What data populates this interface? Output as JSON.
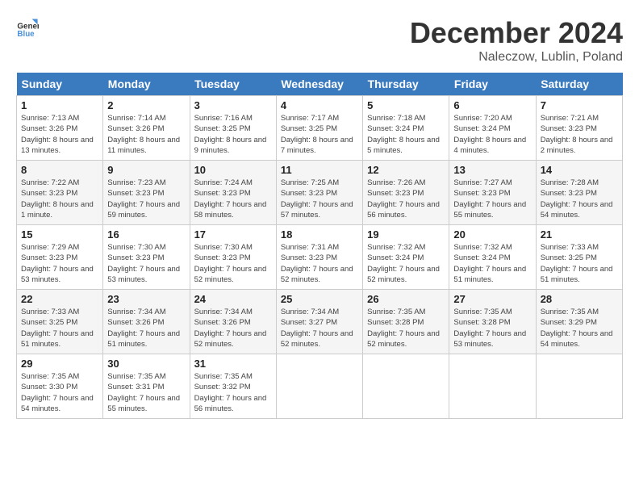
{
  "header": {
    "logo_line1": "General",
    "logo_line2": "Blue",
    "month": "December 2024",
    "location": "Naleczow, Lublin, Poland"
  },
  "weekdays": [
    "Sunday",
    "Monday",
    "Tuesday",
    "Wednesday",
    "Thursday",
    "Friday",
    "Saturday"
  ],
  "weeks": [
    [
      {
        "day": "1",
        "sunrise": "Sunrise: 7:13 AM",
        "sunset": "Sunset: 3:26 PM",
        "daylight": "Daylight: 8 hours and 13 minutes."
      },
      {
        "day": "2",
        "sunrise": "Sunrise: 7:14 AM",
        "sunset": "Sunset: 3:26 PM",
        "daylight": "Daylight: 8 hours and 11 minutes."
      },
      {
        "day": "3",
        "sunrise": "Sunrise: 7:16 AM",
        "sunset": "Sunset: 3:25 PM",
        "daylight": "Daylight: 8 hours and 9 minutes."
      },
      {
        "day": "4",
        "sunrise": "Sunrise: 7:17 AM",
        "sunset": "Sunset: 3:25 PM",
        "daylight": "Daylight: 8 hours and 7 minutes."
      },
      {
        "day": "5",
        "sunrise": "Sunrise: 7:18 AM",
        "sunset": "Sunset: 3:24 PM",
        "daylight": "Daylight: 8 hours and 5 minutes."
      },
      {
        "day": "6",
        "sunrise": "Sunrise: 7:20 AM",
        "sunset": "Sunset: 3:24 PM",
        "daylight": "Daylight: 8 hours and 4 minutes."
      },
      {
        "day": "7",
        "sunrise": "Sunrise: 7:21 AM",
        "sunset": "Sunset: 3:23 PM",
        "daylight": "Daylight: 8 hours and 2 minutes."
      }
    ],
    [
      {
        "day": "8",
        "sunrise": "Sunrise: 7:22 AM",
        "sunset": "Sunset: 3:23 PM",
        "daylight": "Daylight: 8 hours and 1 minute."
      },
      {
        "day": "9",
        "sunrise": "Sunrise: 7:23 AM",
        "sunset": "Sunset: 3:23 PM",
        "daylight": "Daylight: 7 hours and 59 minutes."
      },
      {
        "day": "10",
        "sunrise": "Sunrise: 7:24 AM",
        "sunset": "Sunset: 3:23 PM",
        "daylight": "Daylight: 7 hours and 58 minutes."
      },
      {
        "day": "11",
        "sunrise": "Sunrise: 7:25 AM",
        "sunset": "Sunset: 3:23 PM",
        "daylight": "Daylight: 7 hours and 57 minutes."
      },
      {
        "day": "12",
        "sunrise": "Sunrise: 7:26 AM",
        "sunset": "Sunset: 3:23 PM",
        "daylight": "Daylight: 7 hours and 56 minutes."
      },
      {
        "day": "13",
        "sunrise": "Sunrise: 7:27 AM",
        "sunset": "Sunset: 3:23 PM",
        "daylight": "Daylight: 7 hours and 55 minutes."
      },
      {
        "day": "14",
        "sunrise": "Sunrise: 7:28 AM",
        "sunset": "Sunset: 3:23 PM",
        "daylight": "Daylight: 7 hours and 54 minutes."
      }
    ],
    [
      {
        "day": "15",
        "sunrise": "Sunrise: 7:29 AM",
        "sunset": "Sunset: 3:23 PM",
        "daylight": "Daylight: 7 hours and 53 minutes."
      },
      {
        "day": "16",
        "sunrise": "Sunrise: 7:30 AM",
        "sunset": "Sunset: 3:23 PM",
        "daylight": "Daylight: 7 hours and 53 minutes."
      },
      {
        "day": "17",
        "sunrise": "Sunrise: 7:30 AM",
        "sunset": "Sunset: 3:23 PM",
        "daylight": "Daylight: 7 hours and 52 minutes."
      },
      {
        "day": "18",
        "sunrise": "Sunrise: 7:31 AM",
        "sunset": "Sunset: 3:23 PM",
        "daylight": "Daylight: 7 hours and 52 minutes."
      },
      {
        "day": "19",
        "sunrise": "Sunrise: 7:32 AM",
        "sunset": "Sunset: 3:24 PM",
        "daylight": "Daylight: 7 hours and 52 minutes."
      },
      {
        "day": "20",
        "sunrise": "Sunrise: 7:32 AM",
        "sunset": "Sunset: 3:24 PM",
        "daylight": "Daylight: 7 hours and 51 minutes."
      },
      {
        "day": "21",
        "sunrise": "Sunrise: 7:33 AM",
        "sunset": "Sunset: 3:25 PM",
        "daylight": "Daylight: 7 hours and 51 minutes."
      }
    ],
    [
      {
        "day": "22",
        "sunrise": "Sunrise: 7:33 AM",
        "sunset": "Sunset: 3:25 PM",
        "daylight": "Daylight: 7 hours and 51 minutes."
      },
      {
        "day": "23",
        "sunrise": "Sunrise: 7:34 AM",
        "sunset": "Sunset: 3:26 PM",
        "daylight": "Daylight: 7 hours and 51 minutes."
      },
      {
        "day": "24",
        "sunrise": "Sunrise: 7:34 AM",
        "sunset": "Sunset: 3:26 PM",
        "daylight": "Daylight: 7 hours and 52 minutes."
      },
      {
        "day": "25",
        "sunrise": "Sunrise: 7:34 AM",
        "sunset": "Sunset: 3:27 PM",
        "daylight": "Daylight: 7 hours and 52 minutes."
      },
      {
        "day": "26",
        "sunrise": "Sunrise: 7:35 AM",
        "sunset": "Sunset: 3:28 PM",
        "daylight": "Daylight: 7 hours and 52 minutes."
      },
      {
        "day": "27",
        "sunrise": "Sunrise: 7:35 AM",
        "sunset": "Sunset: 3:28 PM",
        "daylight": "Daylight: 7 hours and 53 minutes."
      },
      {
        "day": "28",
        "sunrise": "Sunrise: 7:35 AM",
        "sunset": "Sunset: 3:29 PM",
        "daylight": "Daylight: 7 hours and 54 minutes."
      }
    ],
    [
      {
        "day": "29",
        "sunrise": "Sunrise: 7:35 AM",
        "sunset": "Sunset: 3:30 PM",
        "daylight": "Daylight: 7 hours and 54 minutes."
      },
      {
        "day": "30",
        "sunrise": "Sunrise: 7:35 AM",
        "sunset": "Sunset: 3:31 PM",
        "daylight": "Daylight: 7 hours and 55 minutes."
      },
      {
        "day": "31",
        "sunrise": "Sunrise: 7:35 AM",
        "sunset": "Sunset: 3:32 PM",
        "daylight": "Daylight: 7 hours and 56 minutes."
      },
      null,
      null,
      null,
      null
    ]
  ]
}
